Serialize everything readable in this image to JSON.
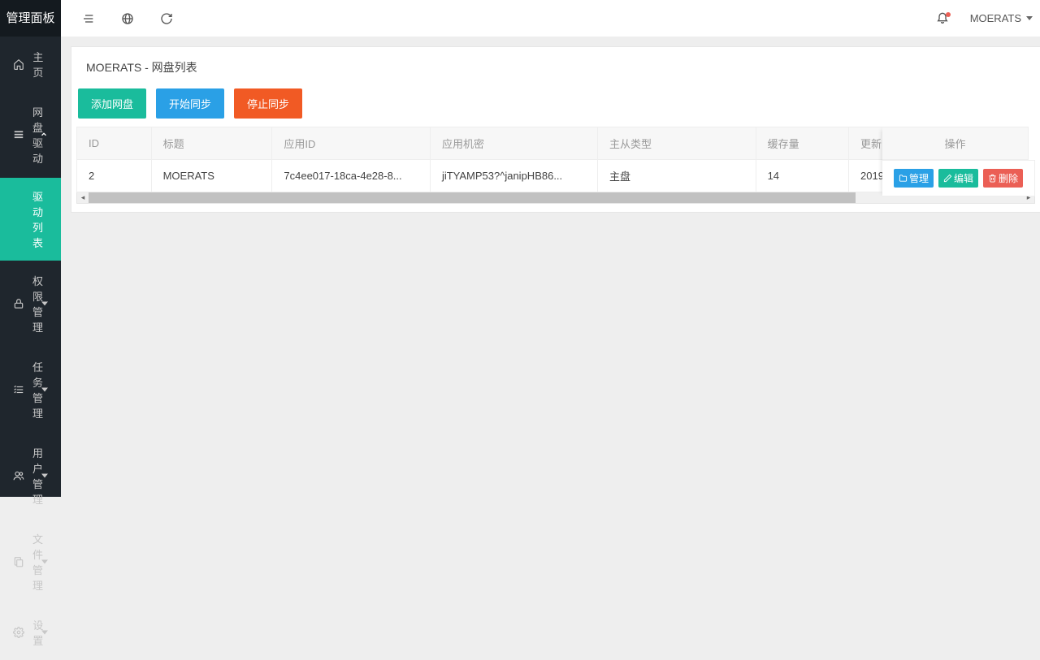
{
  "sidebar": {
    "brand": "管理面板",
    "items": [
      {
        "icon": "home",
        "label": "主页",
        "expandable": false
      },
      {
        "icon": "list",
        "label": "网盘驱动",
        "expandable": true,
        "open": true,
        "children": [
          {
            "label": "驱动列表",
            "active": true
          }
        ]
      },
      {
        "icon": "lock",
        "label": "权限管理",
        "expandable": true
      },
      {
        "icon": "tasks",
        "label": "任务管理",
        "expandable": true
      },
      {
        "icon": "users",
        "label": "用户管理",
        "expandable": true
      },
      {
        "icon": "copy",
        "label": "文件管理",
        "expandable": true
      },
      {
        "icon": "gear",
        "label": "设置",
        "expandable": true
      }
    ]
  },
  "topbar": {
    "user": "MOERATS"
  },
  "panel": {
    "title": "MOERATS - 网盘列表",
    "buttons": {
      "add": "添加网盘",
      "startSync": "开始同步",
      "stopSync": "停止同步"
    },
    "columns": {
      "id": "ID",
      "title": "标题",
      "appid": "应用ID",
      "secret": "应用机密",
      "type": "主从类型",
      "cache": "缓存量",
      "time": "更新时间",
      "actions": "操作"
    },
    "rows": [
      {
        "id": "2",
        "title": "MOERATS",
        "appid": "7c4ee017-18ca-4e28-8...",
        "secret": "jiTYAMP53?^janipHB86...",
        "type": "主盘",
        "cache": "14",
        "time": "2019"
      }
    ],
    "actions": {
      "manage": "管理",
      "edit": "编辑",
      "delete": "删除"
    }
  }
}
